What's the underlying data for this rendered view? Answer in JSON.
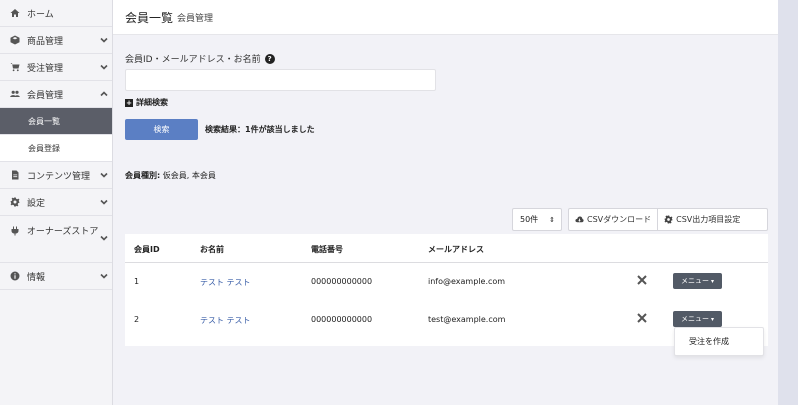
{
  "sidebar": {
    "items": [
      {
        "label": "ホーム",
        "icon": "home-icon"
      },
      {
        "label": "商品管理",
        "icon": "cube-icon"
      },
      {
        "label": "受注管理",
        "icon": "cart-icon"
      },
      {
        "label": "会員管理",
        "icon": "users-icon"
      },
      {
        "label": "コンテンツ管理",
        "icon": "file-icon"
      },
      {
        "label": "設定",
        "icon": "gear-icon"
      },
      {
        "label": "オーナーズストア",
        "icon": "plug-icon"
      },
      {
        "label": "情報",
        "icon": "info-icon"
      }
    ],
    "sub_items": [
      {
        "label": "会員一覧"
      },
      {
        "label": "会員登録"
      }
    ]
  },
  "header": {
    "title": "会員一覧",
    "subtitle": "会員管理"
  },
  "search": {
    "label": "会員ID・メールアドレス・お名前",
    "input_value": "",
    "advanced_label": "詳細検索",
    "button_label": "検索",
    "result_text": "検索結果：1件が該当しました"
  },
  "member_type": {
    "label": "会員種別:",
    "value": "仮会員, 本会員"
  },
  "toolbar": {
    "per_page": "50件",
    "csv_download": "CSVダウンロード",
    "csv_settings": "CSV出力項目設定"
  },
  "table": {
    "headers": [
      "会員ID",
      "お名前",
      "電話番号",
      "メールアドレス"
    ],
    "rows": [
      {
        "id": "1",
        "name": "テスト テスト",
        "phone": "000000000000",
        "email": "info@example.com",
        "menu": "メニュー"
      },
      {
        "id": "2",
        "name": "テスト テスト",
        "phone": "000000000000",
        "email": "test@example.com",
        "menu": "メニュー"
      }
    ]
  },
  "dropdown": {
    "items": [
      "受注を作成"
    ]
  },
  "colors": {
    "primary": "#5b7fc4",
    "sidebar_active": "#5b5e68",
    "menu_button": "#525a66"
  }
}
